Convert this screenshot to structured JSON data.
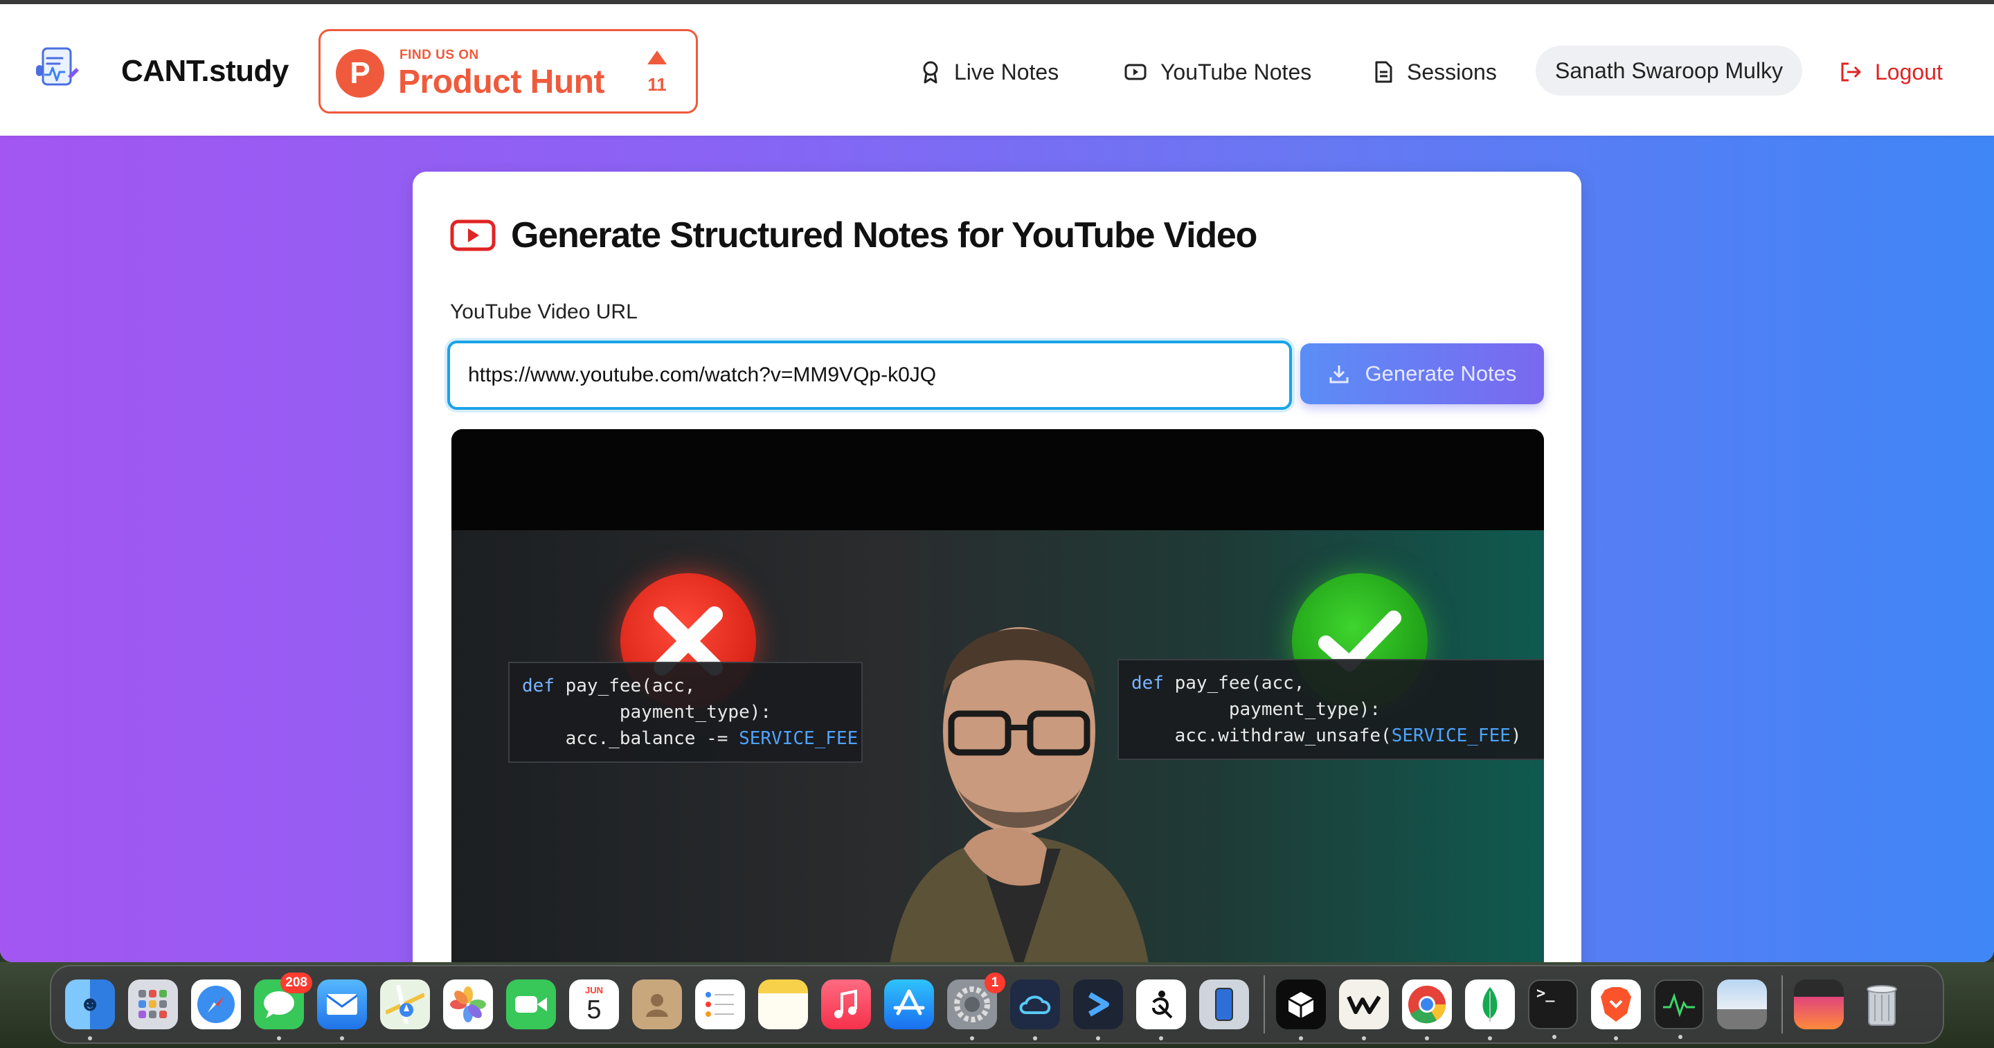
{
  "navbar": {
    "brand": "CANT.study",
    "product_hunt": {
      "small_label": "FIND US ON",
      "big_label": "Product Hunt",
      "upvotes": "11"
    },
    "links": [
      {
        "label": "Live Notes",
        "icon": "award-icon"
      },
      {
        "label": "YouTube Notes",
        "icon": "youtube-icon"
      },
      {
        "label": "Sessions",
        "icon": "document-icon"
      }
    ],
    "user_name": "Sanath Swaroop Mulky",
    "logout_label": "Logout"
  },
  "card": {
    "title": "Generate Structured Notes for YouTube Video",
    "url_label": "YouTube Video URL",
    "url_value": "https://www.youtube.com/watch?v=MM9VQp-k0JQ",
    "generate_label": "Generate Notes"
  },
  "video": {
    "left_code": {
      "line1_kw": "def",
      "line1": " pay_fee(acc,",
      "line2": "         payment_type):",
      "line3": "    acc._balance -= ",
      "line3_const": "SERVICE_FEE"
    },
    "right_code": {
      "line1_kw": "def",
      "line1": " pay_fee(acc,",
      "line2": "         payment_type):",
      "line3": "    acc.withdraw_unsafe(",
      "line3_const": "SERVICE_FEE",
      "line3_end": ")"
    }
  },
  "dock": {
    "messages_badge": "208",
    "settings_badge": "1",
    "calendar_month": "JUN",
    "calendar_day": "5"
  },
  "colors": {
    "accent_red": "#ef5a3c",
    "logout_red": "#e02424",
    "input_focus": "#1aa3e8",
    "gradient_left": "#a356f2",
    "gradient_right": "#3f86f6"
  }
}
